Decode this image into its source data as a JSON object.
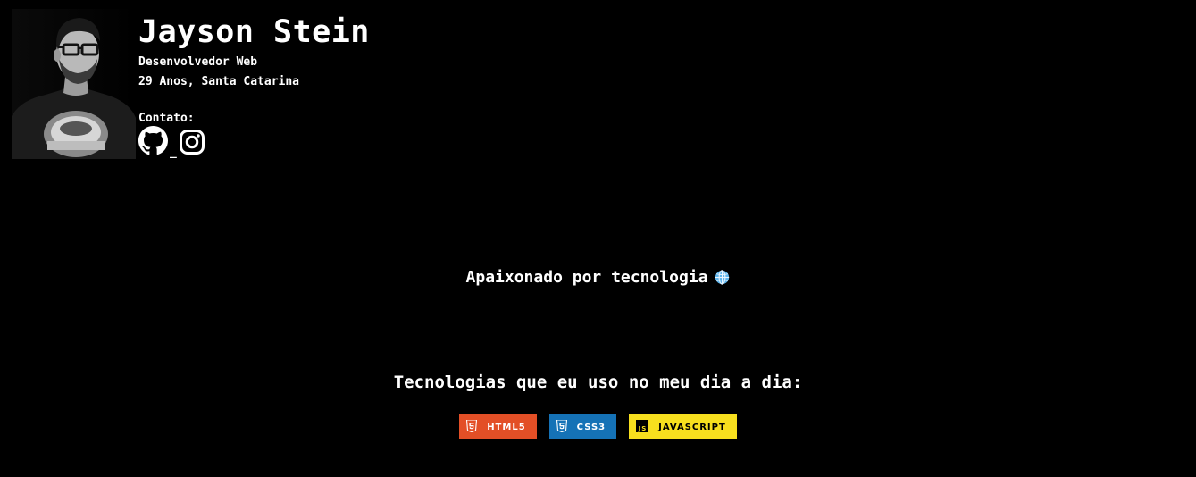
{
  "profile": {
    "name": "Jayson Stein",
    "role": "Desenvolvedor Web",
    "details": "29 Anos, Santa Catarina",
    "contact_label": "Contato:",
    "contact_separator": "_",
    "contacts": [
      {
        "icon": "github-icon"
      },
      {
        "icon": "instagram-icon"
      }
    ]
  },
  "tagline": {
    "text": "Apaixonado por tecnologia",
    "icon": "globe-icon"
  },
  "technologies": {
    "title": "Tecnologias que eu uso no meu dia a dia:",
    "badges": [
      {
        "label": "HTML5",
        "icon": "html5-icon",
        "bg": "#E34F26",
        "fg": "#ffffff"
      },
      {
        "label": "CSS3",
        "icon": "css3-icon",
        "bg": "#1572B6",
        "fg": "#ffffff"
      },
      {
        "label": "JAVASCRIPT",
        "icon": "javascript-icon",
        "bg": "#F7DF1E",
        "fg": "#000000"
      }
    ]
  },
  "colors": {
    "background": "#000000",
    "text": "#ffffff"
  }
}
